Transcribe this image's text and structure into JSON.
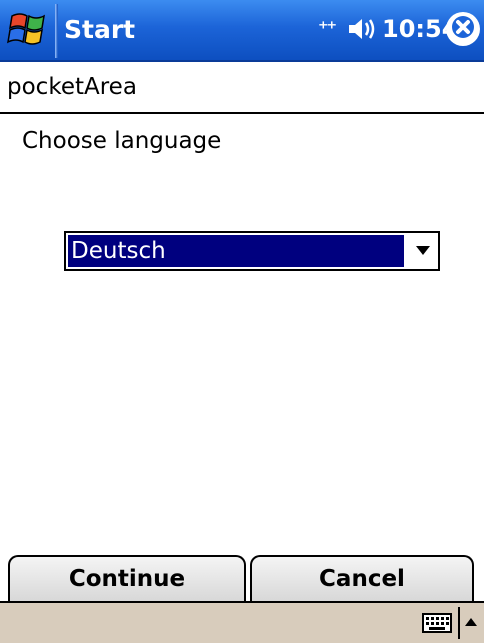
{
  "titlebar": {
    "start_label": "Start",
    "time": "10:54",
    "icons": [
      "windows-flag-icon",
      "connectivity-icon",
      "volume-icon",
      "close-icon"
    ],
    "color": "#1c64d8"
  },
  "app": {
    "title": "pocketArea"
  },
  "content": {
    "prompt": "Choose language",
    "language_select": {
      "selected": "Deutsch",
      "highlight_color": "#00007f"
    }
  },
  "softkeys": {
    "left_label": "Continue",
    "right_label": "Cancel"
  },
  "input_panel": {
    "icons": [
      "keyboard-icon",
      "input-menu-arrow-icon"
    ],
    "background": "#d8ccbc"
  }
}
